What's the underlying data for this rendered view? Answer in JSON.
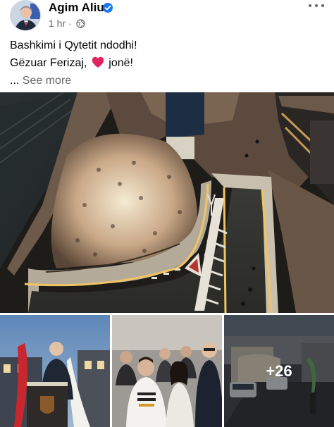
{
  "post": {
    "author": "Agim Aliu",
    "verified_icon": "verified-badge-icon",
    "time": "1 hr",
    "separator": "·",
    "privacy_icon": "globe-icon",
    "more_icon": "ellipsis-icon",
    "text_line1": "Bashkimi i Qytetit ndodhi!",
    "text_line2_before": "Gëzuar Ferizaj,",
    "text_line2_after": "jonë!",
    "heart_icon": "red-heart-icon",
    "see_more_prefix": "...",
    "see_more_label": "See more"
  },
  "media": {
    "main_photo": "aerial-night-crowd-photo",
    "thumb1": "speaker-at-podium-photo",
    "thumb2": "group-of-people-photo",
    "thumb3": "tunnel-street-photo",
    "more_count": "+26"
  },
  "colors": {
    "verified": "#1877f2",
    "secondary_text": "#65676b",
    "heart": "#e0245e"
  }
}
